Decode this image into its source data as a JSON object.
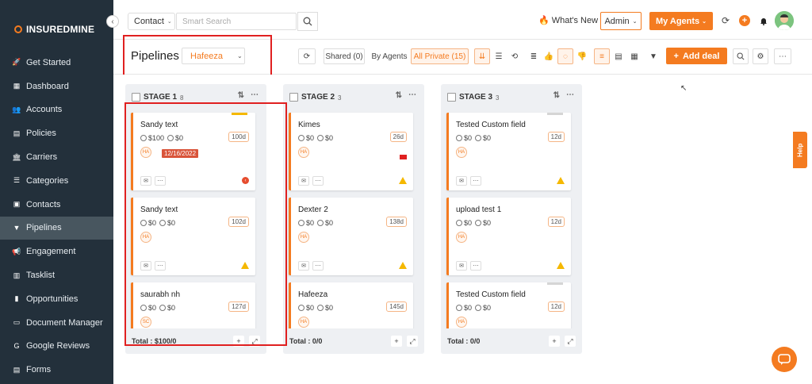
{
  "app": {
    "brand": "INSUREDMINE"
  },
  "sidebar": {
    "items": [
      {
        "label": "Get Started",
        "icon": "rocket-icon",
        "glyph": "🚀"
      },
      {
        "label": "Dashboard",
        "icon": "dashboard-icon",
        "glyph": "▦"
      },
      {
        "label": "Accounts",
        "icon": "accounts-icon",
        "glyph": "👥"
      },
      {
        "label": "Policies",
        "icon": "policies-icon",
        "glyph": "▤"
      },
      {
        "label": "Carriers",
        "icon": "carriers-icon",
        "glyph": "🏛"
      },
      {
        "label": "Categories",
        "icon": "categories-icon",
        "glyph": "☰"
      },
      {
        "label": "Contacts",
        "icon": "contacts-icon",
        "glyph": "▣"
      },
      {
        "label": "Pipelines",
        "icon": "pipelines-icon",
        "glyph": "▼",
        "active": true
      },
      {
        "label": "Engagement",
        "icon": "megaphone-icon",
        "glyph": "📢"
      },
      {
        "label": "Tasklist",
        "icon": "tasklist-icon",
        "glyph": "▥"
      },
      {
        "label": "Opportunities",
        "icon": "opportunities-icon",
        "glyph": "▮"
      },
      {
        "label": "Document Manager",
        "icon": "folder-icon",
        "glyph": "▭"
      },
      {
        "label": "Google Reviews",
        "icon": "google-icon",
        "glyph": "G"
      },
      {
        "label": "Forms",
        "icon": "forms-icon",
        "glyph": "▤"
      }
    ]
  },
  "topbar": {
    "contact_select": "Contact",
    "search_placeholder": "Smart Search",
    "whats_new": "What's New",
    "admin": "Admin",
    "my_agents": "My Agents"
  },
  "pipeline_header": {
    "title": "Pipelines",
    "selected_pipeline": "Hafeeza",
    "shared": "Shared (0)",
    "by_agents": "By Agents",
    "all_private": "All Private (15)",
    "add_deal": "Add deal"
  },
  "stages": [
    {
      "name": "STAGE 1",
      "count": "8",
      "total": "Total : $100/0",
      "cards": [
        {
          "title": "Sandy text",
          "amount1": "$100",
          "amount2": "$0",
          "days": "100d",
          "initials": "HA",
          "date": "12/16/2022",
          "flag": "red-dot",
          "accent": "yellow"
        },
        {
          "title": "Sandy text",
          "amount1": "$0",
          "amount2": "$0",
          "days": "102d",
          "initials": "HA",
          "flag": "warning"
        },
        {
          "title": "saurabh nh",
          "amount1": "$0",
          "amount2": "$0",
          "days": "127d",
          "initials": "SC"
        }
      ]
    },
    {
      "name": "STAGE 2",
      "count": "3",
      "total": "Total : 0/0",
      "cards": [
        {
          "title": "Kimes",
          "amount1": "$0",
          "amount2": "$0",
          "days": "26d",
          "initials": "HA",
          "flag": "warning",
          "redflag": true
        },
        {
          "title": "Dexter 2",
          "amount1": "$0",
          "amount2": "$0",
          "days": "138d",
          "initials": "HA",
          "flag": "warning"
        },
        {
          "title": "Hafeeza",
          "amount1": "$0",
          "amount2": "$0",
          "days": "145d",
          "initials": "HA"
        }
      ]
    },
    {
      "name": "STAGE 3",
      "count": "3",
      "total": "Total : 0/0",
      "cards": [
        {
          "title": "Tested Custom field",
          "amount1": "$0",
          "amount2": "$0",
          "days": "12d",
          "initials": "HA",
          "flag": "warning",
          "accent": "grey"
        },
        {
          "title": "upload test 1",
          "amount1": "$0",
          "amount2": "$0",
          "days": "12d",
          "initials": "HA",
          "flag": "warning"
        },
        {
          "title": "Tested Custom field",
          "amount1": "$0",
          "amount2": "$0",
          "days": "12d",
          "initials": "HA",
          "accent": "grey"
        }
      ]
    }
  ],
  "help": "Help",
  "colors": {
    "accent": "#f47b20",
    "sidebar": "#23303b",
    "highlight": "#e02020"
  }
}
